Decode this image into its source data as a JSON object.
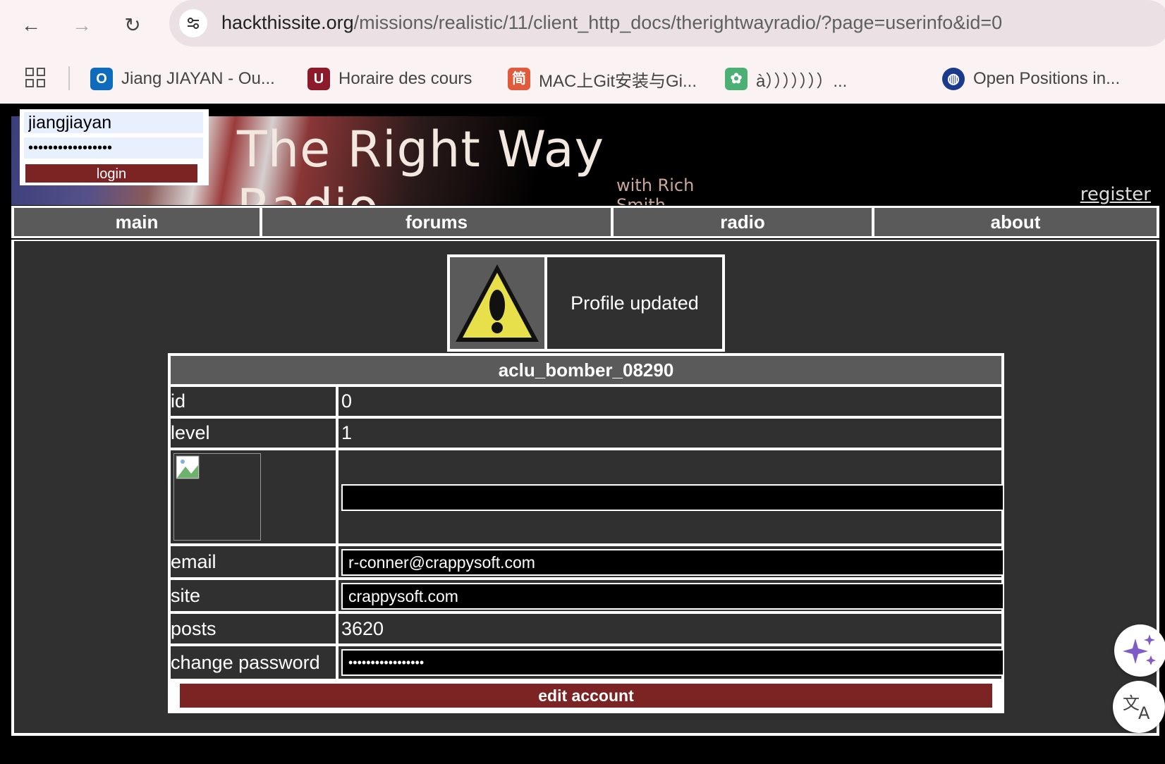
{
  "browser": {
    "url_domain": "hackthissite.org",
    "url_path": "/missions/realistic/11/client_http_docs/therightwayradio/?page=userinfo&id=0",
    "bookmarks": [
      {
        "label": "Jiang JIAYAN - Ou...",
        "icon": "outlook-icon",
        "color": "#0f6cbd"
      },
      {
        "label": "Horaire des cours",
        "icon": "university-logo-icon",
        "color": "#8b1a2b"
      },
      {
        "label": "MAC上Git安装与Gi...",
        "icon": "jianshu-icon",
        "color": "#e05a3c"
      },
      {
        "label": "à）））））））...",
        "icon": "paw-icon",
        "color": "#4caf74"
      },
      {
        "label": "Open Positions in...",
        "icon": "globe-icon",
        "color": "#1a3a8c"
      }
    ]
  },
  "site": {
    "title": "The Right Way Radio",
    "subtitle": "with Rich Smith",
    "register_label": "register",
    "login": {
      "username": "jiangjiayan",
      "password": "•••••••••••••••••",
      "button_label": "login"
    },
    "nav": [
      "main",
      "forums",
      "radio",
      "about"
    ]
  },
  "message": {
    "text": "Profile updated",
    "icon": "warning-icon"
  },
  "profile": {
    "username": "aclu_bomber_08290",
    "rows": {
      "id_label": "id",
      "id_value": "0",
      "level_label": "level",
      "level_value": "1",
      "avatar_value": "",
      "email_label": "email",
      "email_value": "r-conner@crappysoft.com",
      "site_label": "site",
      "site_value": "crappysoft.com",
      "posts_label": "posts",
      "posts_value": "3620",
      "password_label": "change password",
      "password_value": "•••••••••••••••••"
    },
    "edit_button_label": "edit account"
  }
}
